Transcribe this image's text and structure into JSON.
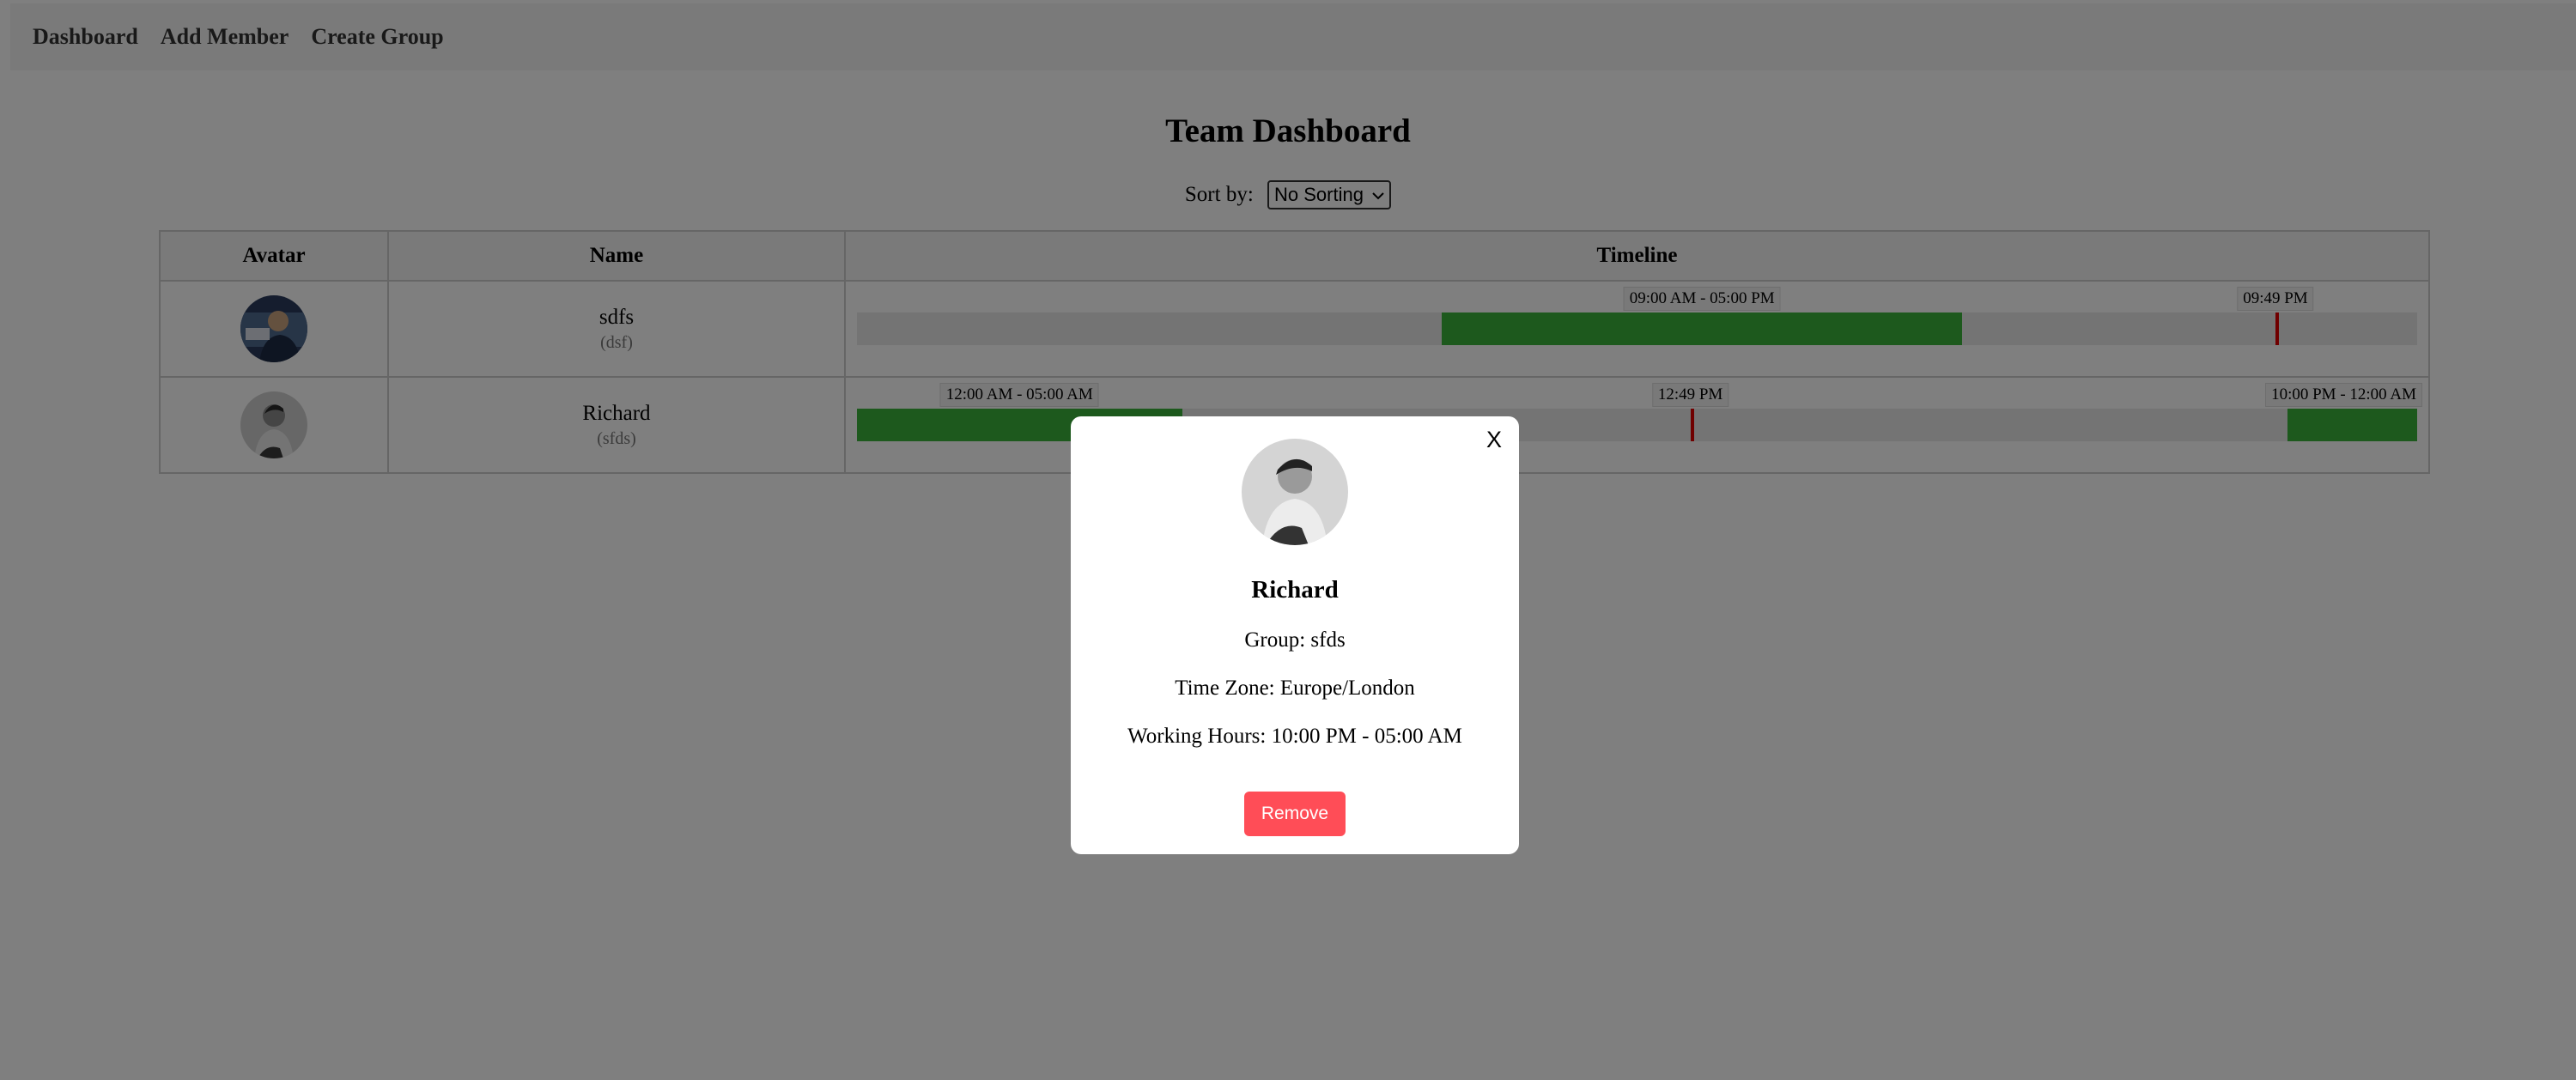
{
  "nav": {
    "items": [
      {
        "label": "Dashboard"
      },
      {
        "label": "Add Member"
      },
      {
        "label": "Create Group"
      }
    ]
  },
  "page": {
    "title": "Team Dashboard",
    "sort_label": "Sort by:",
    "sort_selected": "No Sorting"
  },
  "table": {
    "headers": {
      "avatar": "Avatar",
      "name": "Name",
      "timeline": "Timeline"
    },
    "rows": [
      {
        "name": "sdfs",
        "group": "(dsf)",
        "working_hours_label": "09:00 AM - 05:00 PM",
        "current_time_label": "09:49 PM",
        "working_start_hour": 9,
        "working_end_hour": 17,
        "current_hour": 21.82
      },
      {
        "name": "Richard",
        "group": "(sfds)",
        "working_hours_label_1": "12:00 AM - 05:00 AM",
        "working_hours_label_2": "10:00 PM - 12:00 AM",
        "current_time_label": "12:49 PM",
        "working_start_hour": 22,
        "working_end_hour": 5,
        "current_hour": 12.82
      }
    ]
  },
  "modal": {
    "close_label": "X",
    "name": "Richard",
    "group": "Group: sfds",
    "time_zone": "Time Zone: Europe/London",
    "working_hours": "Working Hours: 10:00 PM - 05:00 AM",
    "remove_label": "Remove"
  },
  "colors": {
    "working": "#3bb23b",
    "current_time": "#e00000",
    "remove_button": "#ff4d57"
  },
  "icons": {
    "sort_dropdown": "chevron-down-icon"
  }
}
